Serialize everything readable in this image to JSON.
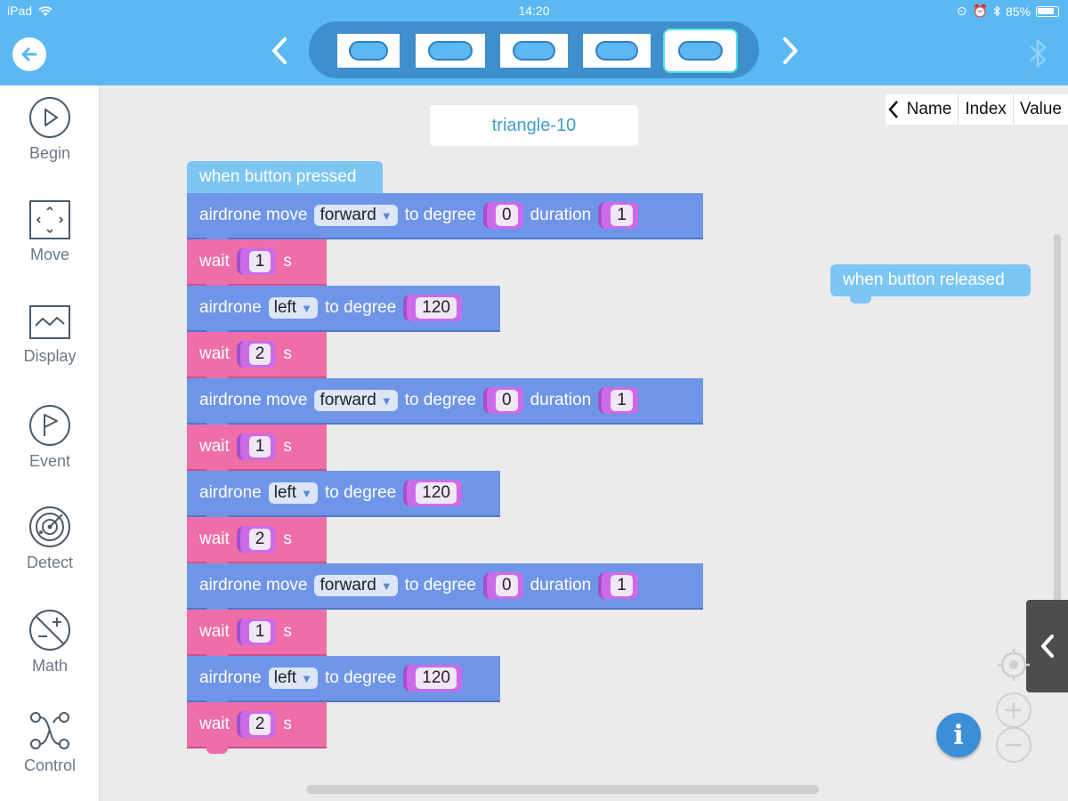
{
  "status": {
    "device": "iPad",
    "time": "14:20",
    "battery": "85%"
  },
  "toolbar": {
    "tabs": [
      {
        "icon": "block-tab-icon",
        "active": false
      },
      {
        "icon": "block-tab-icon",
        "active": false
      },
      {
        "icon": "block-tab-icon",
        "active": false
      },
      {
        "icon": "block-tab-icon",
        "active": false
      },
      {
        "icon": "block-tab-icon",
        "active": true
      }
    ]
  },
  "sidebar": {
    "items": [
      {
        "label": "Begin",
        "icon": "play-icon"
      },
      {
        "label": "Move",
        "icon": "move-icon"
      },
      {
        "label": "Display",
        "icon": "display-icon"
      },
      {
        "label": "Event",
        "icon": "flag-icon"
      },
      {
        "label": "Detect",
        "icon": "radar-icon"
      },
      {
        "label": "Math",
        "icon": "math-icon"
      },
      {
        "label": "Control",
        "icon": "control-icon"
      }
    ]
  },
  "workspace": {
    "program_name": "triangle-10",
    "variables_header": {
      "name": "Name",
      "index": "Index",
      "value": "Value"
    },
    "hat_pressed": "when button pressed",
    "hat_released": "when button released",
    "labels": {
      "airdrone_move": "airdrone move",
      "airdrone": "airdrone",
      "to_degree": "to degree",
      "duration": "duration",
      "wait": "wait",
      "seconds": "s"
    },
    "blocks": [
      {
        "type": "move",
        "direction": "forward",
        "degree": "0",
        "duration": "1"
      },
      {
        "type": "wait",
        "value": "1"
      },
      {
        "type": "turn",
        "direction": "left",
        "degree": "120"
      },
      {
        "type": "wait",
        "value": "2"
      },
      {
        "type": "move",
        "direction": "forward",
        "degree": "0",
        "duration": "1"
      },
      {
        "type": "wait",
        "value": "1"
      },
      {
        "type": "turn",
        "direction": "left",
        "degree": "120"
      },
      {
        "type": "wait",
        "value": "2"
      },
      {
        "type": "move",
        "direction": "forward",
        "degree": "0",
        "duration": "1"
      },
      {
        "type": "wait",
        "value": "1"
      },
      {
        "type": "turn",
        "direction": "left",
        "degree": "120"
      },
      {
        "type": "wait",
        "value": "2"
      }
    ],
    "info_label": "i"
  },
  "colors": {
    "topbar": "#5bb8f3",
    "move_block": "#6f95e8",
    "wait_block": "#ee6fa8",
    "hat_block": "#7cc6f4",
    "value_slot": "#cc6be8"
  }
}
